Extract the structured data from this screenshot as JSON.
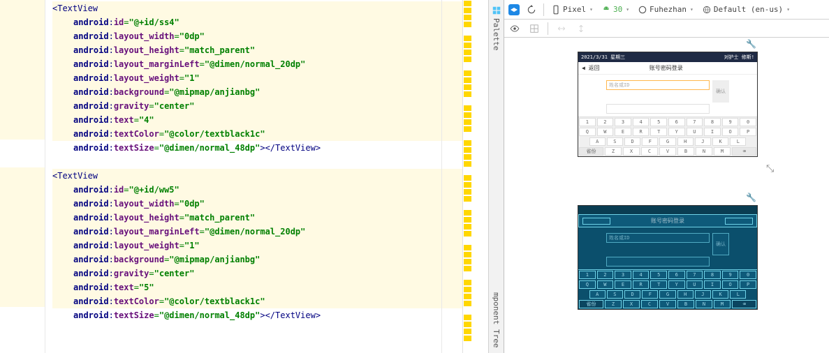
{
  "code": {
    "tag": "TextView",
    "ns": "android",
    "items": [
      {
        "id": "@+id/ss4",
        "attrs": [
          {
            "k": "id",
            "v": "@+id/ss4"
          },
          {
            "k": "layout_width",
            "v": "0dp"
          },
          {
            "k": "layout_height",
            "v": "match_parent"
          },
          {
            "k": "layout_marginLeft",
            "v": "@dimen/normal_20dp"
          },
          {
            "k": "layout_weight",
            "v": "1"
          },
          {
            "k": "background",
            "v": "@mipmap/anjianbg"
          },
          {
            "k": "gravity",
            "v": "center"
          },
          {
            "k": "text",
            "v": "4"
          },
          {
            "k": "textColor",
            "v": "@color/textblack1c"
          },
          {
            "k": "textSize",
            "v": "@dimen/normal_48dp"
          }
        ]
      },
      {
        "id": "@+id/ww5",
        "attrs": [
          {
            "k": "id",
            "v": "@+id/ww5"
          },
          {
            "k": "layout_width",
            "v": "0dp"
          },
          {
            "k": "layout_height",
            "v": "match_parent"
          },
          {
            "k": "layout_marginLeft",
            "v": "@dimen/normal_20dp"
          },
          {
            "k": "layout_weight",
            "v": "1"
          },
          {
            "k": "background",
            "v": "@mipmap/anjianbg"
          },
          {
            "k": "gravity",
            "v": "center"
          },
          {
            "k": "text",
            "v": "5"
          },
          {
            "k": "textColor",
            "v": "@color/textblack1c"
          },
          {
            "k": "textSize",
            "v": "@dimen/normal_48dp"
          }
        ]
      }
    ]
  },
  "sidetabs": {
    "palette": "Palette",
    "component_tree": "mponent Tree"
  },
  "toolbar": {
    "device": "Pixel",
    "api": "30",
    "theme": "Fuhezhan",
    "locale": "Default (en-us)"
  },
  "preview": {
    "statusbar_date": "2021/3/31 星期三",
    "statusbar_right": "对护士 修斯! ",
    "back": "返回",
    "title": "账号密码登录",
    "placeholder1": "姓名或ID",
    "btn": "确认",
    "kb_row1": [
      "1",
      "2",
      "3",
      "4",
      "5",
      "6",
      "7",
      "8",
      "9",
      "0"
    ],
    "kb_row2": [
      "Q",
      "W",
      "E",
      "R",
      "T",
      "Y",
      "U",
      "I",
      "O",
      "P"
    ],
    "kb_row3": [
      "A",
      "S",
      "D",
      "F",
      "G",
      "H",
      "J",
      "K",
      "L"
    ],
    "kb_row4_l": "省份",
    "kb_row4": [
      "Z",
      "X",
      "C",
      "V",
      "B",
      "N",
      "M"
    ],
    "kb_row4_r": "⌫"
  }
}
